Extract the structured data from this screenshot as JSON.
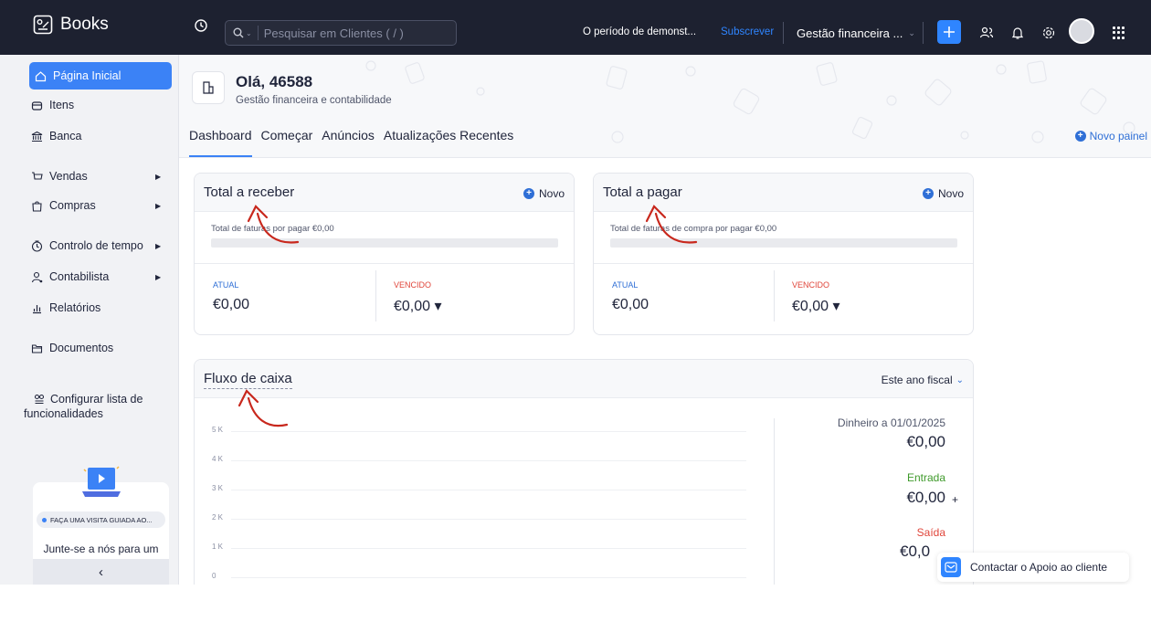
{
  "topbar": {
    "logo_text": "Books",
    "search_placeholder": "Pesquisar em Clientes ( / )",
    "demo_text": "O período de demonst...",
    "subscribe_label": "Subscrever",
    "org_name": "Gestão financeira ...",
    "colors": {
      "bg": "#1d2130",
      "accent": "#2f85ff"
    }
  },
  "sidebar": {
    "items": [
      {
        "label": "Página Inicial",
        "icon": "home-icon"
      },
      {
        "label": "Itens",
        "icon": "tag-icon"
      },
      {
        "label": "Banca",
        "icon": "bank-icon"
      },
      {
        "label": "Vendas",
        "icon": "cart-icon"
      },
      {
        "label": "Compras",
        "icon": "bag-icon"
      },
      {
        "label": "Controlo de tempo",
        "icon": "clock-icon"
      },
      {
        "label": "Contabilista",
        "icon": "user-icon"
      },
      {
        "label": "Relatórios",
        "icon": "chart-icon"
      },
      {
        "label": "Documentos",
        "icon": "folder-icon"
      }
    ],
    "config_line1": "Configurar lista de",
    "config_line2": "funcionalidades",
    "tour_badge": "FAÇA UMA VISITA GUIADA AO...",
    "tour_text": "Junte-se a nós para um",
    "collapse": "‹"
  },
  "header": {
    "greeting": "Olá, 46588",
    "subtitle": "Gestão financeira e contabilidade",
    "tabs": [
      "Dashboard",
      "Começar",
      "Anúncios",
      "Atualizações Recentes"
    ],
    "new_panel": "Novo painel"
  },
  "receivables": {
    "title": "Total a receber",
    "new_label": "Novo",
    "unpaid_text": "Total de faturas por pagar €0,00",
    "current_label": "ATUAL",
    "current_value": "€0,00",
    "overdue_label": "VENCIDO",
    "overdue_value": "€0,00 ▾"
  },
  "payables": {
    "title": "Total a pagar",
    "new_label": "Novo",
    "unpaid_text": "Total de faturas de compra por pagar €0,00",
    "current_label": "ATUAL",
    "current_value": "€0,00",
    "overdue_label": "VENCIDO",
    "overdue_value": "€0,00 ▾"
  },
  "cashflow": {
    "title": "Fluxo de caixa",
    "period": "Este ano fiscal",
    "cash_label": "Dinheiro a 01/01/2025",
    "cash_value": "€0,00",
    "in_label": "Entrada",
    "in_value": "€0,00",
    "in_sign": "+",
    "out_label": "Saída",
    "out_value": "€0,0",
    "colors": {
      "in": "#3f9a2b",
      "out": "#e0453a"
    }
  },
  "chart_data": {
    "type": "line",
    "title": "",
    "y_ticks": [
      "5 K",
      "4 K",
      "3 K",
      "2 K",
      "1 K",
      "0"
    ],
    "ylim": [
      0,
      5000
    ],
    "series": []
  },
  "chat": {
    "label": "Contactar o Apoio ao cliente"
  }
}
